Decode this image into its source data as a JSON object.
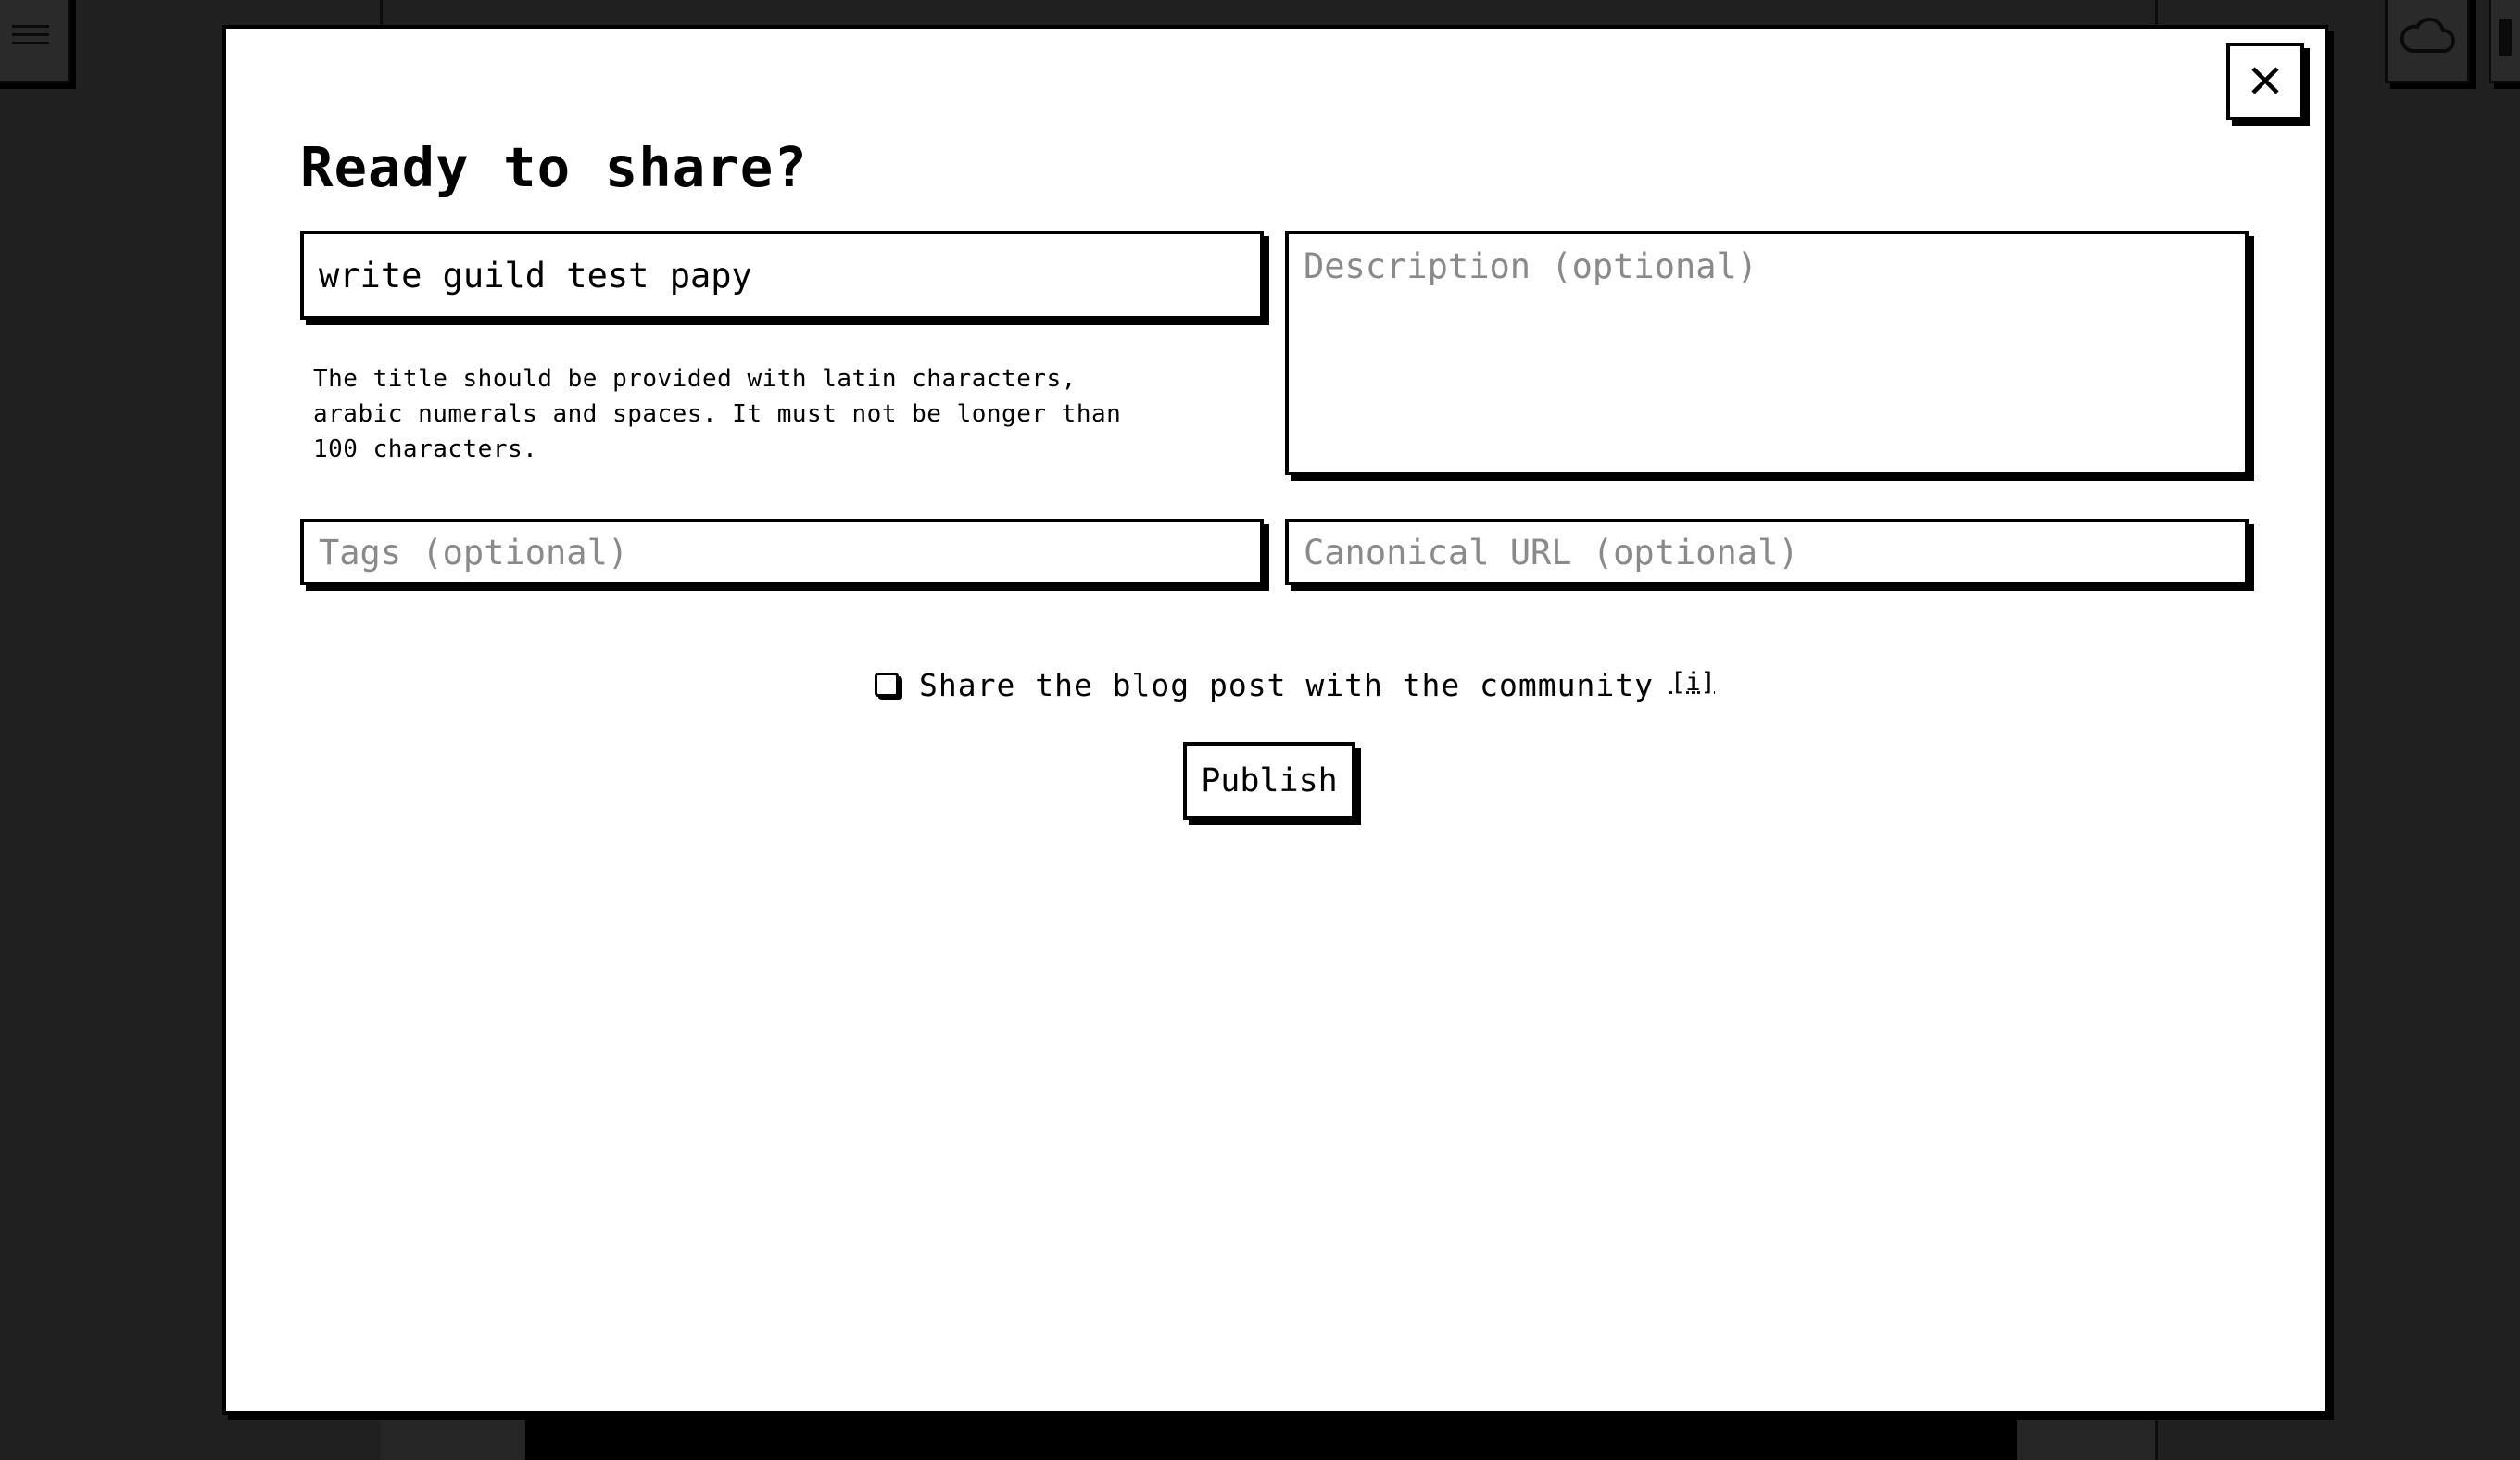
{
  "background": {
    "menu_icon": "hamburger-menu-icon",
    "cloud_icon": "cloud-icon"
  },
  "modal": {
    "title": "Ready to share?",
    "close_icon": "close-icon",
    "title_input": {
      "value": "write guild test papy"
    },
    "title_hint": "The title should be provided with latin characters, arabic numerals and spaces. It must not be longer than 100 characters.",
    "description_input": {
      "value": "",
      "placeholder": "Description (optional)"
    },
    "tags_input": {
      "value": "",
      "placeholder": "Tags (optional)"
    },
    "canonical_url_input": {
      "value": "",
      "placeholder": "Canonical URL (optional)"
    },
    "share_community": {
      "checked": false,
      "label": "Share the blog post with the community",
      "info_link": "[i]"
    },
    "publish_label": "Publish"
  }
}
